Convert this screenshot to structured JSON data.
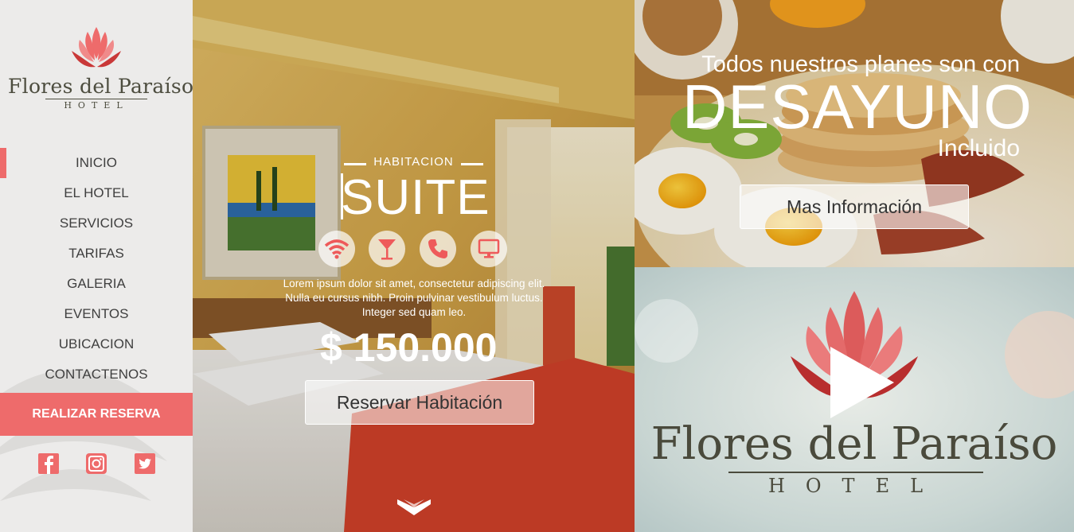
{
  "brand": {
    "name": "Flores del Paraíso",
    "subtitle": "HOTEL"
  },
  "nav": {
    "items": [
      {
        "label": "INICIO",
        "active": true
      },
      {
        "label": "EL HOTEL"
      },
      {
        "label": "SERVICIOS"
      },
      {
        "label": "TARIFAS"
      },
      {
        "label": "GALERIA"
      },
      {
        "label": "EVENTOS"
      },
      {
        "label": "UBICACION"
      },
      {
        "label": "CONTACTENOS"
      }
    ],
    "reserve_label": "REALIZAR RESERVA"
  },
  "social": [
    "facebook-icon",
    "instagram-icon",
    "twitter-icon"
  ],
  "room": {
    "label": "HABITACION",
    "name": "SUITE",
    "amenities": [
      "wifi-icon",
      "cocktail-icon",
      "phone-icon",
      "tv-icon"
    ],
    "description": "Lorem ipsum dolor sit amet, consectetur adipiscing elit. Nulla eu cursus nibh. Proin pulvinar vestibulum luctus. Integer sed quam leo.",
    "price": "$ 150.000",
    "book_label": "Reservar Habitación"
  },
  "breakfast": {
    "line1": "Todos nuestros planes son con",
    "highlight": "DESAYUNO",
    "line3": "Incluido",
    "button_label": "Mas Información"
  },
  "video": {
    "title": "Flores del Paraíso",
    "subtitle": "HOTEL"
  },
  "colors": {
    "accent": "#ee6b6b",
    "sidebar_bg": "#ecebea",
    "text_dark": "#3f3f3f"
  }
}
